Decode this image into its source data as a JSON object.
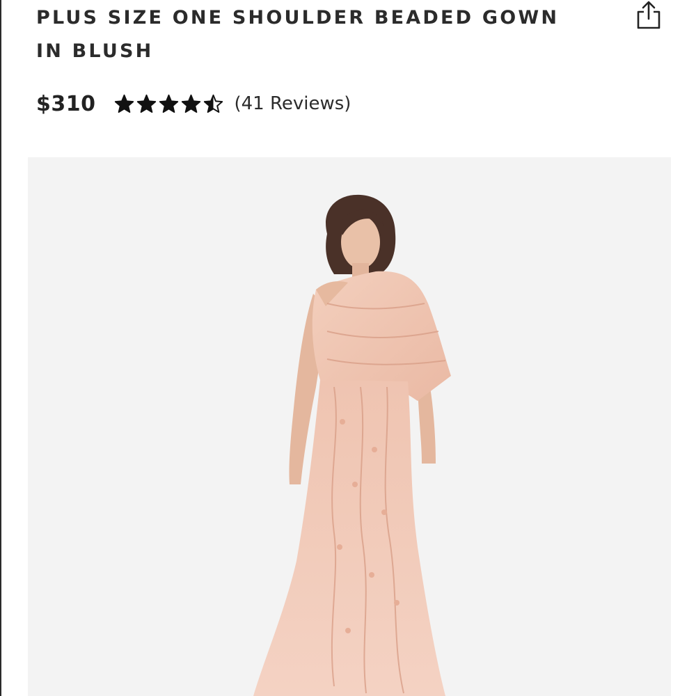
{
  "product": {
    "title": "PLUS SIZE ONE SHOULDER BEADED GOWN IN BLUSH",
    "price": "$310",
    "rating": 4.5,
    "rating_max": 5,
    "reviews_label": "(41 Reviews)"
  },
  "icons": {
    "share": "share-icon",
    "star": "star-icon"
  },
  "colors": {
    "image_background": "#f3f3f3",
    "dress": "#f1c9b6",
    "text": "#2b2b2b"
  }
}
